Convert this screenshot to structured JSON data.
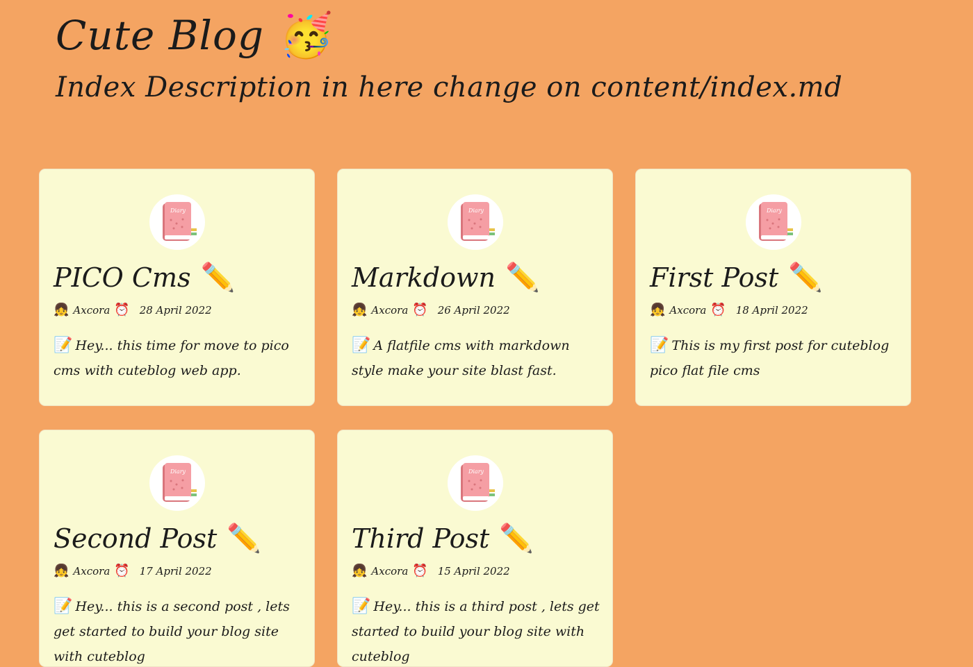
{
  "site": {
    "title": "Cute Blog",
    "title_emoji": "🥳",
    "description": "Index Description in here change on content/index.md"
  },
  "icons": {
    "pencil": "✏️",
    "author": "👧",
    "clock": "⏰",
    "memo": "📝"
  },
  "avatar_label": "Diary",
  "posts": [
    {
      "title": "PICO Cms",
      "author": "Axcora",
      "date": "28 April 2022",
      "excerpt": "Hey... this time for move to pico cms with cuteblog web app."
    },
    {
      "title": "Markdown",
      "author": "Axcora",
      "date": "26 April 2022",
      "excerpt": "A flatfile cms with markdown style make your site blast fast."
    },
    {
      "title": "First Post",
      "author": "Axcora",
      "date": "18 April 2022",
      "excerpt": "This is my first post for cuteblog pico flat file cms"
    },
    {
      "title": "Second Post",
      "author": "Axcora",
      "date": "17 April 2022",
      "excerpt": "Hey... this is a second post , lets get started to build your blog site with cuteblog"
    },
    {
      "title": "Third Post",
      "author": "Axcora",
      "date": "15 April 2022",
      "excerpt": "Hey... this is a third post , lets get started to build your blog site with cuteblog"
    }
  ],
  "colors": {
    "background": "#f4a462",
    "card": "#fafad2",
    "diary_book": "#f59ea4",
    "diary_spine": "#d9757c"
  }
}
